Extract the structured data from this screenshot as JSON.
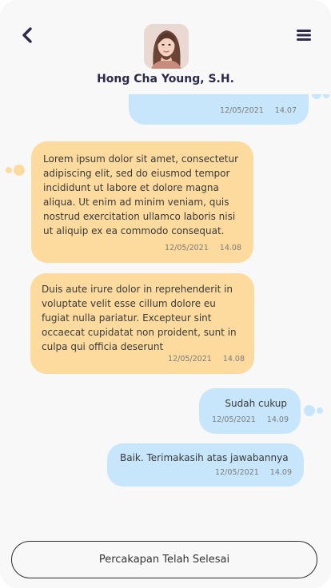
{
  "header": {
    "contact_name": "Hong Cha Young, S.H.",
    "back_icon": "chevron-left-icon",
    "menu_icon": "hamburger-menu-icon"
  },
  "messages": [
    {
      "direction": "out",
      "text": "",
      "date": "12/05/2021",
      "time": "14.07"
    },
    {
      "direction": "in",
      "text": "Lorem ipsum dolor sit amet, consectetur adipiscing elit, sed do eiusmod tempor incididunt ut labore et dolore magna aliqua. Ut enim ad minim veniam, quis nostrud exercitation ullamco laboris nisi ut aliquip ex ea commodo consequat.",
      "date": "12/05/2021",
      "time": "14.08"
    },
    {
      "direction": "in",
      "text": "Duis aute irure dolor in reprehenderit in voluptate velit esse cillum dolore eu fugiat nulla pariatur. Excepteur sint occaecat cupidatat non proident, sunt in culpa qui officia deserunt",
      "date": "12/05/2021",
      "time": "14.08"
    },
    {
      "direction": "out",
      "text": "Sudah cukup",
      "date": "12/05/2021",
      "time": "14.09"
    },
    {
      "direction": "out",
      "text": "Baik. Terimakasih atas jawabannya",
      "date": "12/05/2021",
      "time": "14.09"
    }
  ],
  "footer": {
    "end_label": "Percakapan Telah Selesai"
  },
  "colors": {
    "incoming_bubble": "#fdda9e",
    "outgoing_bubble": "#c7e6fb",
    "title_text": "#2d2a4a"
  }
}
